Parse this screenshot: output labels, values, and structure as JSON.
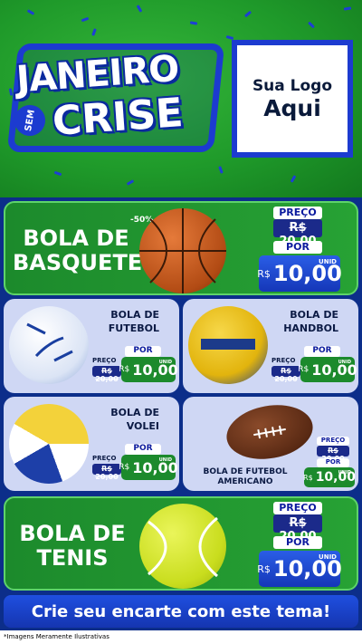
{
  "hero": {
    "title_line1": "JANEIRO",
    "title_sem": "SEM",
    "title_line2": "CRISE",
    "logo_line1": "Sua Logo",
    "logo_line2": "Aqui"
  },
  "products": {
    "basquete": {
      "name": "BOLA DE BASQUETE",
      "discount": "-50%",
      "price_label": "PREÇO",
      "old_price": "R$ 20,00",
      "por": "POR",
      "currency": "R$",
      "new_price": "10,00",
      "unit": "UNID"
    },
    "futebol": {
      "name": "BOLA DE FUTEBOL",
      "price_label": "PREÇO",
      "old_price": "R$ 20,00",
      "por": "POR",
      "currency": "R$",
      "new_price": "10,00",
      "unit": "UNID"
    },
    "handbol": {
      "name": "BOLA DE HANDBOL",
      "price_label": "PREÇO",
      "old_price": "R$ 20,00",
      "por": "POR",
      "currency": "R$",
      "new_price": "10,00",
      "unit": "UNID"
    },
    "volei": {
      "name": "BOLA DE VOLEI",
      "price_label": "PREÇO",
      "old_price": "R$ 20,00",
      "por": "POR",
      "currency": "R$",
      "new_price": "10,00",
      "unit": "UNID"
    },
    "americano": {
      "name": "BOLA DE FUTEBOL AMERICANO",
      "price_label": "PREÇO",
      "old_price": "R$ 20,00",
      "por": "POR",
      "currency": "R$",
      "new_price": "10,00",
      "unit": "UNID"
    },
    "tenis": {
      "name": "BOLA DE TENIS",
      "price_label": "PREÇO",
      "old_price": "R$ 20,00",
      "por": "POR",
      "currency": "R$",
      "new_price": "10,00",
      "unit": "UNID"
    }
  },
  "cta": "Crie seu encarte com este tema!",
  "footer_note": "*Imagens Meramente Ilustrativas",
  "colors": {
    "brand_blue": "#1c3bd0",
    "brand_green": "#1f9a2a"
  }
}
